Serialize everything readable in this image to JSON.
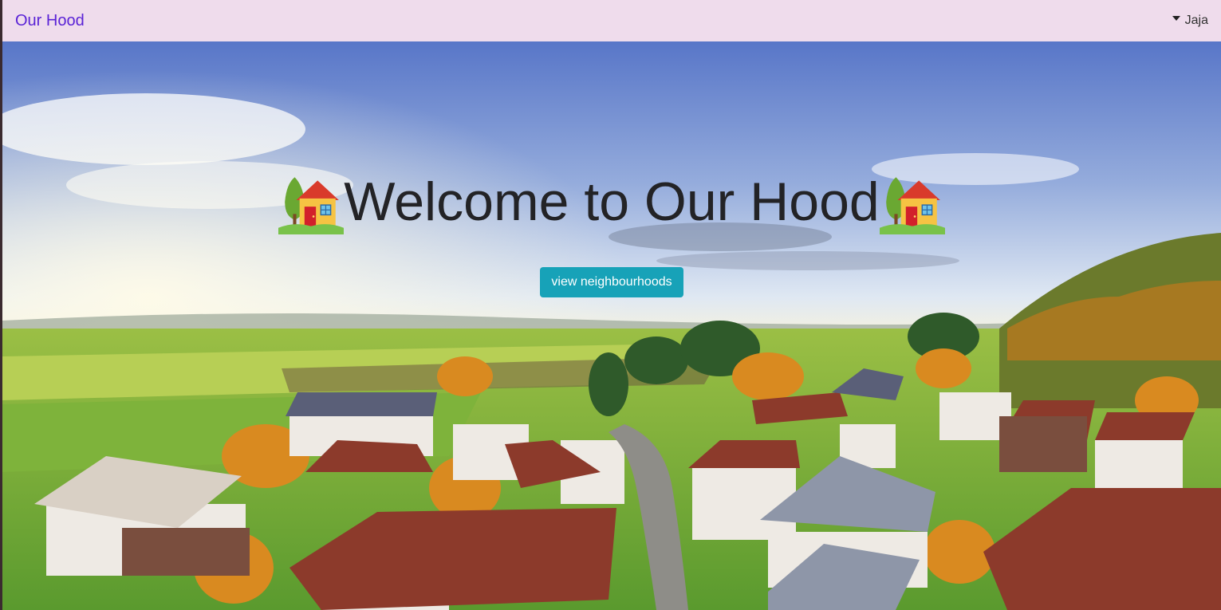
{
  "navbar": {
    "brand": "Our Hood",
    "user_name": "Jaja",
    "brand_color": "#5a23d6",
    "background_color": "#efdcec"
  },
  "hero": {
    "title": "Welcome to Our Hood",
    "title_icon": "house-with-garden-icon",
    "button_label": "view neighbourhoods",
    "button_color": "#17a2b8",
    "background_image": "village-landscape-photo"
  }
}
